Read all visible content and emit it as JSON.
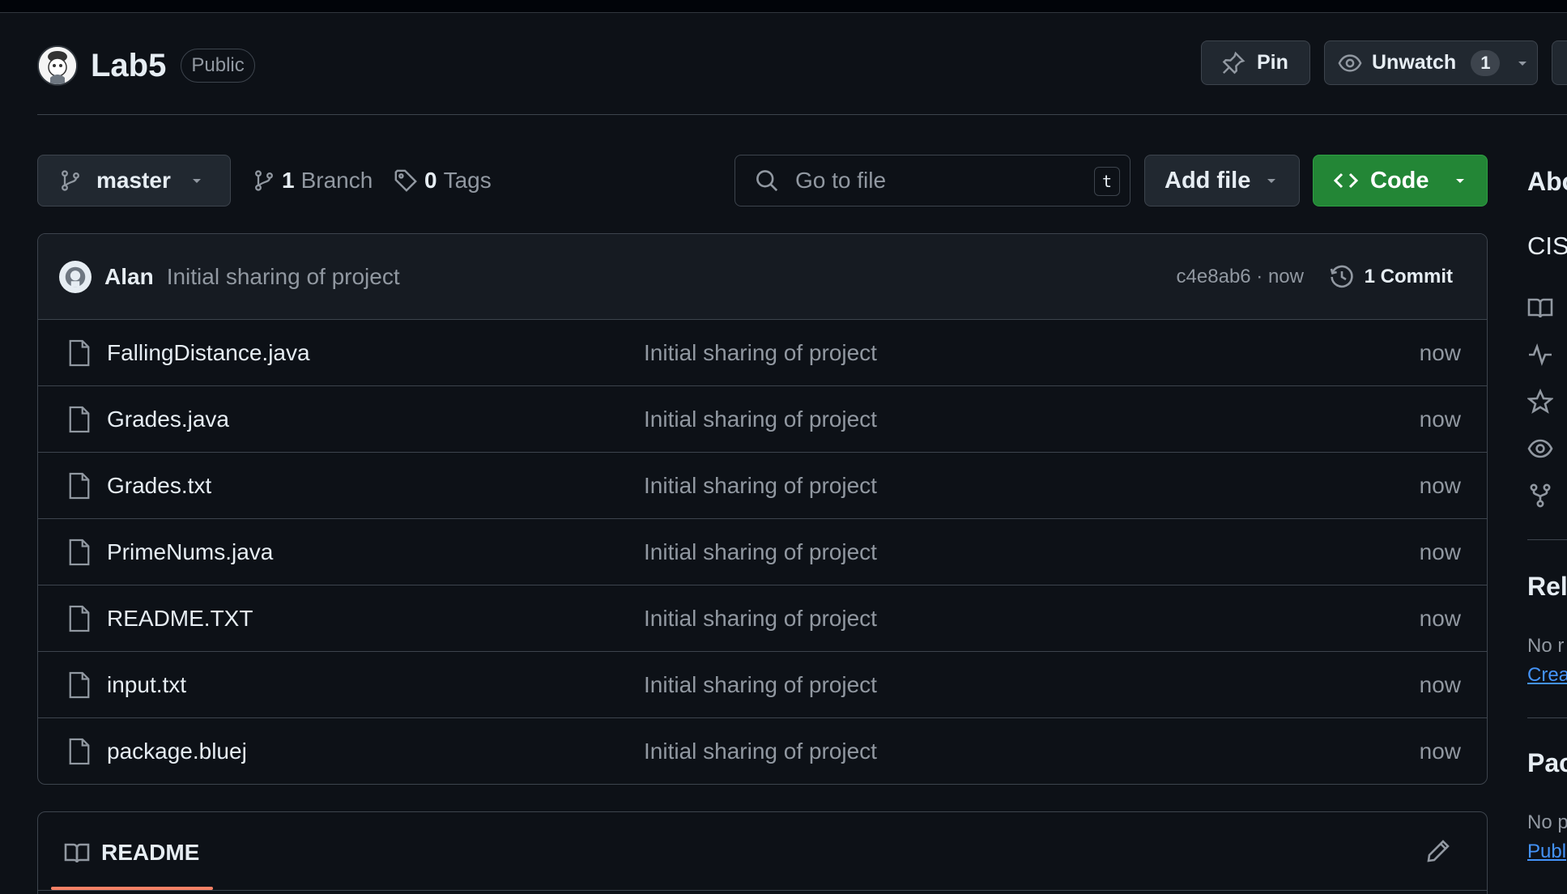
{
  "repo": {
    "name": "Lab5",
    "visibility": "Public"
  },
  "header_actions": {
    "pin_label": "Pin",
    "watch_label": "Unwatch",
    "watch_count": "1"
  },
  "toolbar": {
    "branch": "master",
    "branch_count": "1",
    "branch_word": "Branch",
    "tag_count": "0",
    "tag_word": "Tags",
    "search_placeholder": "Go to file",
    "search_shortcut": "t",
    "add_file_label": "Add file",
    "code_label": "Code"
  },
  "latest_commit": {
    "author": "Alan",
    "message": "Initial sharing of project",
    "hash_time": "c4e8ab6 · now",
    "commit_count": "1 Commit"
  },
  "files": [
    {
      "name": "FallingDistance.java",
      "message": "Initial sharing of project",
      "time": "now"
    },
    {
      "name": "Grades.java",
      "message": "Initial sharing of project",
      "time": "now"
    },
    {
      "name": "Grades.txt",
      "message": "Initial sharing of project",
      "time": "now"
    },
    {
      "name": "PrimeNums.java",
      "message": "Initial sharing of project",
      "time": "now"
    },
    {
      "name": "README.TXT",
      "message": "Initial sharing of project",
      "time": "now"
    },
    {
      "name": "input.txt",
      "message": "Initial sharing of project",
      "time": "now"
    },
    {
      "name": "package.bluej",
      "message": "Initial sharing of project",
      "time": "now"
    }
  ],
  "readme": {
    "title": "README"
  },
  "sidebar": {
    "about_heading": "Abo",
    "description": "CIS",
    "icons": [
      "book-icon",
      "pulse-icon",
      "star-icon",
      "eye-icon",
      "fork-icon"
    ],
    "releases_heading": "Rel",
    "releases_text": "No r",
    "releases_link": "Crea",
    "packages_heading": "Pac",
    "packages_text": "No p",
    "packages_link": "Publ"
  },
  "colors": {
    "background": "#0d1117",
    "border": "#3d444d",
    "code_button": "#238636",
    "link": "#4493f8",
    "readme_accent": "#f78166"
  }
}
